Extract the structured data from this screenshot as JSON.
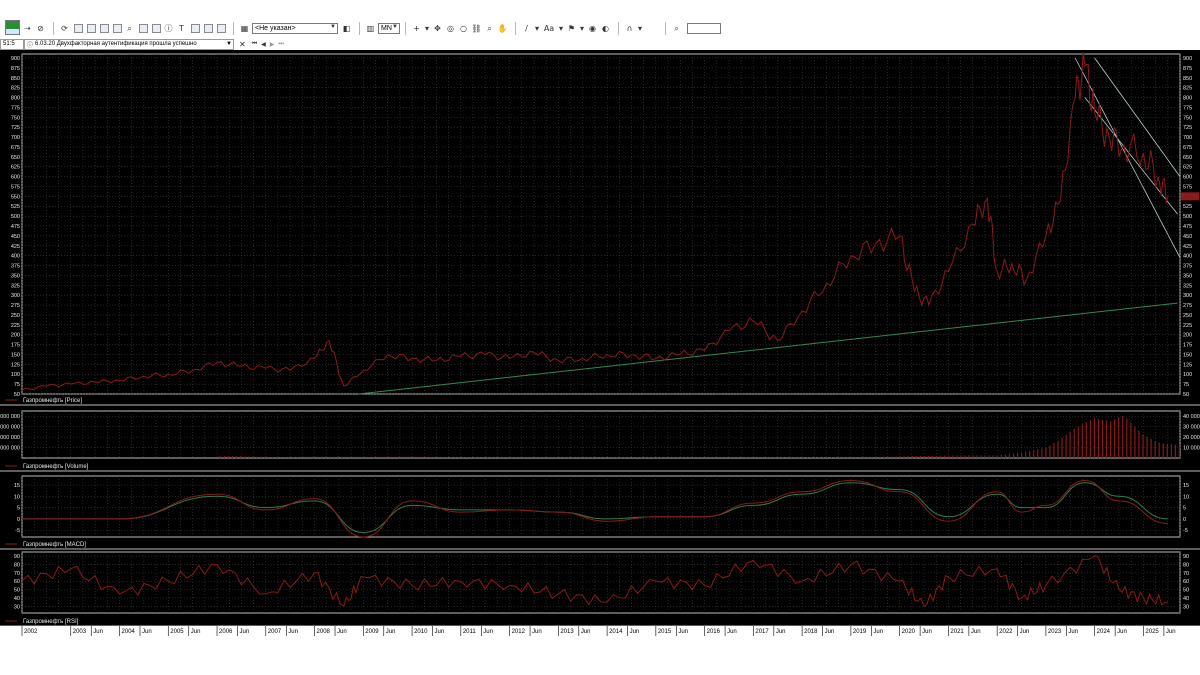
{
  "toolbar": {
    "instrument_select_value": "<Не указан>",
    "period_select_value": "MN",
    "text_tool_label": "Aa",
    "search_value": ""
  },
  "status": {
    "time": "51:5",
    "message": "6.03.20  Двухфакторная аутентификация прошла успешно"
  },
  "colors": {
    "background": "#000000",
    "price_line": "#8b1a1a",
    "macd_line": "#8b1a1a",
    "signal_line": "#2e7d4f",
    "trendline": "#2e8b57",
    "channel_lines": "#b8cfc8",
    "grid": "#4a4a4a"
  },
  "chart_data": [
    {
      "type": "line",
      "title": "Газпромнефть [Price]",
      "ylim": [
        50,
        900
      ],
      "yticks": [
        "50",
        "75",
        "100",
        "125",
        "150",
        "175",
        "200",
        "225",
        "250",
        "275",
        "300",
        "325",
        "350",
        "375",
        "400",
        "425",
        "450",
        "475",
        "500",
        "525",
        "550",
        "575",
        "600",
        "625",
        "650",
        "675",
        "700",
        "725",
        "750",
        "775",
        "800",
        "825",
        "850",
        "875",
        "900"
      ],
      "series": [
        {
          "name": "Газпромнефть",
          "x": [
            2002.0,
            2002.5,
            2003.0,
            2003.5,
            2004.0,
            2004.5,
            2005.0,
            2005.5,
            2006.0,
            2006.5,
            2007.0,
            2007.5,
            2008.0,
            2008.3,
            2008.6,
            2009.0,
            2009.5,
            2010.0,
            2010.5,
            2011.0,
            2011.5,
            2012.0,
            2012.5,
            2013.0,
            2013.5,
            2014.0,
            2014.5,
            2015.0,
            2015.5,
            2016.0,
            2016.5,
            2017.0,
            2017.5,
            2018.0,
            2018.5,
            2019.0,
            2019.5,
            2020.0,
            2020.3,
            2020.6,
            2021.0,
            2021.5,
            2021.8,
            2022.0,
            2022.3,
            2022.6,
            2023.0,
            2023.3,
            2023.6,
            2023.8,
            2024.0,
            2024.3,
            2024.6,
            2025.0,
            2025.3,
            2025.5
          ],
          "values": [
            60,
            70,
            75,
            80,
            85,
            95,
            100,
            110,
            130,
            120,
            115,
            110,
            140,
            185,
            70,
            110,
            150,
            140,
            135,
            145,
            150,
            140,
            155,
            135,
            140,
            150,
            150,
            140,
            150,
            160,
            210,
            235,
            185,
            260,
            330,
            400,
            430,
            450,
            310,
            275,
            360,
            480,
            545,
            360,
            380,
            340,
            450,
            540,
            800,
            880,
            760,
            700,
            680,
            660,
            600,
            550
          ]
        }
      ]
    },
    {
      "type": "bar",
      "title": "Газпромнефть [Volume]",
      "yticks_left": [
        "000 000",
        "000 000",
        "000 000",
        "000 000"
      ],
      "yticks_right": [
        "40 000",
        "30 000",
        "20 000",
        "10 000"
      ],
      "series": [
        {
          "name": "Газпромнефть",
          "x": [
            2006.0,
            2007.0,
            2008.0,
            2009.0,
            2010.0,
            2011.0,
            2012.0,
            2013.0,
            2014.0,
            2015.0,
            2016.0,
            2017.0,
            2018.0,
            2019.0,
            2020.0,
            2021.0,
            2022.0,
            2022.5,
            2023.0,
            2023.3,
            2023.6,
            2024.0,
            2024.3,
            2024.6,
            2025.0,
            2025.3
          ],
          "values": [
            2000,
            1500,
            1800,
            1200,
            1500,
            1300,
            1200,
            1000,
            1100,
            900,
            1000,
            1000,
            900,
            1200,
            1500,
            2500,
            3500,
            8000,
            12000,
            20000,
            30000,
            38000,
            35000,
            42000,
            25000,
            18000
          ]
        }
      ]
    },
    {
      "type": "line",
      "title": "Газпромнефть [MACD]",
      "yticks": [
        "15",
        "10",
        "5",
        "0",
        "-5"
      ],
      "series": [
        {
          "name": "Газпромнефть",
          "x": [
            2002,
            2004,
            2006,
            2007,
            2008,
            2009,
            2010,
            2011,
            2012,
            2013,
            2014,
            2015,
            2016,
            2017,
            2018,
            2019,
            2020,
            2021,
            2022,
            2022.5,
            2023,
            2023.8,
            2024.5,
            2025.5
          ],
          "values": [
            0,
            0,
            11,
            4,
            9,
            -8,
            8,
            3,
            4,
            3,
            -1,
            1,
            1,
            7,
            12,
            17,
            12,
            -1,
            12,
            3,
            6,
            17,
            8,
            -2
          ]
        },
        {
          "x": [
            2002,
            2004,
            2006,
            2007,
            2008,
            2009,
            2010,
            2011,
            2012,
            2013,
            2014,
            2015,
            2016,
            2017,
            2018,
            2019,
            2020,
            2021,
            2022,
            2022.5,
            2023,
            2023.8,
            2024.5,
            2025.5
          ],
          "values": [
            0,
            0,
            10,
            5,
            8,
            -6,
            6,
            4,
            4,
            3,
            0,
            1,
            1,
            6,
            11,
            16,
            13,
            1,
            11,
            5,
            5,
            16,
            10,
            0
          ]
        }
      ]
    },
    {
      "type": "line",
      "title": "Газпромнефть [RSI]",
      "yticks": [
        "90",
        "80",
        "70",
        "60",
        "50",
        "40",
        "30"
      ],
      "series": [
        {
          "name": "Газпромнефть",
          "x": [
            2002,
            2003,
            2004,
            2005,
            2006,
            2007,
            2008,
            2008.6,
            2009,
            2010,
            2011,
            2012,
            2013,
            2014,
            2015,
            2016,
            2017,
            2018,
            2019,
            2020,
            2020.5,
            2021,
            2022,
            2022.5,
            2023,
            2024,
            2024.5,
            2025,
            2025.5
          ],
          "values": [
            60,
            75,
            45,
            60,
            80,
            45,
            70,
            30,
            65,
            55,
            60,
            55,
            45,
            35,
            60,
            55,
            85,
            60,
            80,
            60,
            30,
            65,
            75,
            40,
            55,
            90,
            50,
            40,
            35
          ]
        }
      ]
    }
  ],
  "x_axis_labels": [
    "2002",
    "2003",
    "Jun",
    "2004",
    "Jun",
    "2005",
    "Jun",
    "2006",
    "Jun",
    "2007",
    "Jun",
    "2008",
    "Jun",
    "2009",
    "Jun",
    "2010",
    "Jun",
    "2011",
    "Jun",
    "2012",
    "Jun",
    "2013",
    "Jun",
    "2014",
    "Jun",
    "2015",
    "Jun",
    "2016",
    "Jun",
    "2017",
    "Jun",
    "2018",
    "Jun",
    "2019",
    "Jun",
    "2020",
    "Jun",
    "2021",
    "Jun",
    "2022",
    "Jun",
    "2023",
    "Jun",
    "2024",
    "Jun",
    "2025",
    "Jun"
  ]
}
